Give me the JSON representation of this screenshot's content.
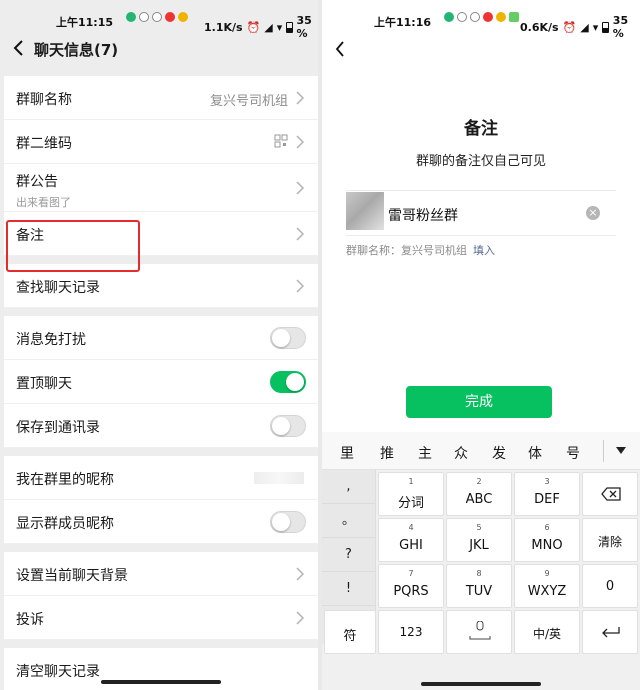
{
  "left": {
    "status": {
      "time": "上午11:15",
      "speed": "1.1K/s",
      "battery": "35 %"
    },
    "header": {
      "title": "聊天信息(7)"
    },
    "rows": {
      "group_name": {
        "label": "群聊名称",
        "value": "复兴号司机组"
      },
      "qr_code": {
        "label": "群二维码"
      },
      "notice": {
        "label": "群公告",
        "sub": "出来看图了"
      },
      "remark": {
        "label": "备注"
      },
      "search_history": {
        "label": "查找聊天记录"
      },
      "mute": {
        "label": "消息免打扰",
        "on": false
      },
      "pin": {
        "label": "置顶聊天",
        "on": true
      },
      "save_contacts": {
        "label": "保存到通讯录",
        "on": false
      },
      "my_nickname": {
        "label": "我在群里的昵称"
      },
      "show_nicknames": {
        "label": "显示群成员昵称",
        "on": false
      },
      "background": {
        "label": "设置当前聊天背景"
      },
      "report": {
        "label": "投诉"
      },
      "clear_history": {
        "label": "清空聊天记录"
      }
    }
  },
  "right": {
    "status": {
      "time": "上午11:16",
      "speed": "0.6K/s",
      "battery": "35 %"
    },
    "title": "备注",
    "subtitle": "群聊的备注仅自己可见",
    "input_value": "雷哥粉丝群",
    "hint_prefix": "群聊名称：复兴号司机组",
    "hint_fill": "填入",
    "done_label": "完成",
    "keyboard": {
      "candidates": [
        "里",
        "推",
        "主",
        "众",
        "发",
        "体",
        "号"
      ],
      "punct": [
        ",",
        "。",
        "?",
        "!"
      ],
      "keys": [
        {
          "n": "1",
          "t": "分词"
        },
        {
          "n": "2",
          "t": "ABC"
        },
        {
          "n": "3",
          "t": "DEF"
        },
        {
          "n": "4",
          "t": "GHI"
        },
        {
          "n": "5",
          "t": "JKL"
        },
        {
          "n": "6",
          "t": "MNO"
        },
        {
          "n": "7",
          "t": "PQRS"
        },
        {
          "n": "8",
          "t": "TUV"
        },
        {
          "n": "9",
          "t": "WXYZ"
        }
      ],
      "clear_label": "清除",
      "zero_label": "0",
      "symbol_label": "符",
      "num_label": "123",
      "lang_label": "中/英"
    }
  },
  "colors": {
    "accent": "#07c160",
    "highlight": "#e52b2b",
    "link": "#576b95"
  }
}
